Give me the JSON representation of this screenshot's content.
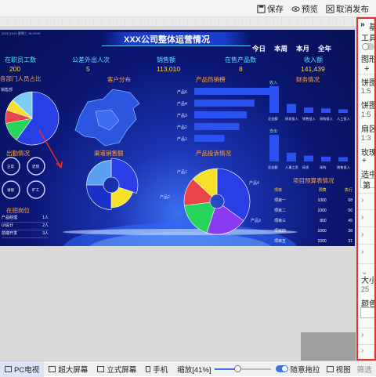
{
  "toolbar": {
    "save_label": "保存",
    "preview_label": "预览",
    "unpublish_label": "取消发布"
  },
  "dashboard": {
    "title": "XXX公司整体运营情况",
    "timestamp": "2021/11/10 星期三 15:20:59",
    "time_tabs": [
      "今日",
      "本周",
      "本月",
      "全年"
    ],
    "kpis": [
      {
        "label": "在职员工数",
        "value": "200"
      },
      {
        "label": "公差外出人次",
        "value": "5"
      },
      {
        "label": "销售额",
        "value": "113,010"
      },
      {
        "label": "在售产品数",
        "value": "8"
      },
      {
        "label": "收入额",
        "value": "141,439"
      }
    ],
    "dept_title": "各部门人员占比",
    "dept_pie_label": "销售部",
    "dept_pie": [
      {
        "value": 60,
        "color": "#2a3ee6"
      },
      {
        "value": 12,
        "color": "#25d65a"
      },
      {
        "value": 8,
        "color": "#e8444a"
      },
      {
        "value": 7,
        "color": "#f5e12a"
      },
      {
        "value": 13,
        "color": "#7ccdf5"
      }
    ],
    "customer_title": "客户分布",
    "hot_title": "产品热销榜",
    "hot_products": [
      {
        "label": "产品5",
        "value": 100
      },
      {
        "label": "产品4",
        "value": 80
      },
      {
        "label": "产品3",
        "value": 70
      },
      {
        "label": "产品2",
        "value": 60
      },
      {
        "label": "产品1",
        "value": 40
      }
    ],
    "finance_title": "财务情况",
    "finance_income_label": "收入",
    "finance_expense_label": "支出",
    "finance_groups_top": [
      "总金额",
      "研发投入",
      "销售投入",
      "采购投入",
      "人工投入"
    ],
    "finance_groups_bottom": [
      "总金额",
      "人事工资",
      "研发",
      "采购",
      "销售投入"
    ],
    "finance_top_values": [
      60,
      20,
      12,
      10,
      8
    ],
    "finance_bottom_values": [
      55,
      18,
      12,
      10,
      9
    ],
    "outing_title": "出勤情况",
    "outing_gauges": [
      {
        "label": "正常"
      },
      {
        "label": "迟到"
      },
      {
        "label": "请假"
      },
      {
        "label": "旷工"
      }
    ],
    "staff_title": "在招岗位",
    "staff_rows": [
      [
        "产品经理",
        "1人"
      ],
      [
        "UI设计",
        "2人"
      ],
      [
        "前端开发",
        "3人"
      ]
    ],
    "channel_title": "渠道销售额",
    "channel_pie": [
      {
        "value": 30,
        "color": "#2a3ee6"
      },
      {
        "value": 20,
        "color": "#f5e12a"
      },
      {
        "value": 25,
        "color": "#1a2fc8"
      },
      {
        "value": 25,
        "color": "#5aa0f0"
      }
    ],
    "complaint_title": "产品投诉情况",
    "complaint_pie": [
      {
        "value": 35,
        "color": "#2a3ee6"
      },
      {
        "value": 20,
        "color": "#8a3af0"
      },
      {
        "value": 18,
        "color": "#25d65a"
      },
      {
        "value": 14,
        "color": "#e8444a"
      },
      {
        "value": 13,
        "color": "#f5e12a"
      }
    ],
    "complaint_labels": [
      "产品1",
      "产品2",
      "产品3",
      "产品4"
    ],
    "project_title": "项目预算表情况",
    "project_headers": [
      "项目",
      "预算",
      "执行"
    ],
    "project_rows": [
      [
        "项目一",
        "1000",
        "68"
      ],
      [
        "项目二",
        "1000",
        "56"
      ],
      [
        "项目三",
        "800",
        "45"
      ],
      [
        "项目四",
        "1000",
        "38"
      ],
      [
        "项目五",
        "1000",
        "31"
      ]
    ]
  },
  "right_panel": {
    "header": "基",
    "tool_label": "工具",
    "shape_label": "图形",
    "pie_label": "饼图",
    "pie_value": "1:5",
    "pie2_label": "饼图",
    "pie2_value": "1:5",
    "fan_label": "扇区",
    "fan_value": "1:3",
    "rose_label": "玫瑰",
    "add_label": "+",
    "selected_label": "选中",
    "selected_value": "第",
    "size_label": "大小",
    "size_value": "25",
    "color_label": "颜色"
  },
  "statusbar": {
    "pc_label": "PC电视",
    "bigscreen_label": "超大屏幕",
    "vertical_label": "立式屏幕",
    "mobile_label": "手机",
    "zoom_label": "缩放[41%]",
    "zoom_value": 41,
    "guide_label": "随意拖拉",
    "view_label": "视图",
    "filter_label": "筛选"
  },
  "colors": {
    "accent_red": "#e0322e",
    "dash_blue": "#0b1673",
    "kpi_cyan": "#55e6ff",
    "title_yellow": "#ffd84a"
  }
}
